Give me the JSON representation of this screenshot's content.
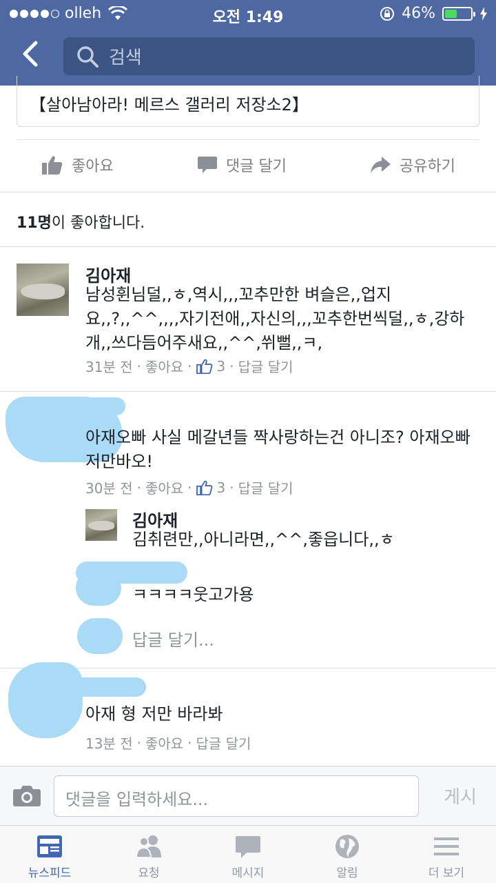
{
  "status_bar": {
    "carrier": "olleh",
    "time": "오전 1:49",
    "battery": "46%",
    "battery_level": 0.46
  },
  "search": {
    "placeholder": "검색"
  },
  "post": {
    "title_fragment": "【살아남아라! 메르스 갤러리 저장소2】"
  },
  "actions": {
    "like": "좋아요",
    "comment": "댓글 달기",
    "share": "공유하기"
  },
  "likes": {
    "count": "11명",
    "suffix": "이 좋아합니다."
  },
  "comments": [
    {
      "author": "김아재",
      "text": "남성휜님덜,,ㅎ,역시,,,꼬추만한 벼슬은,,업지요,,?,,^^,,,,자기전애,,자신의,,,꼬추한번씩덜,,ㅎ,강하개,,쓰다듬어주새요,,^^,쒸뻘,,ㅋ,",
      "time": "31분 전",
      "like": "좋아요",
      "like_count": "3",
      "reply": "답글 달기"
    },
    {
      "author": "",
      "text": "아재오빠 사실 메갈년들 짝사랑하는건 아니조? 아재오빠 저만바오!",
      "time": "30분 전",
      "like": "좋아요",
      "like_count": "3",
      "reply": "답글 달기",
      "replies": [
        {
          "author": "김아재",
          "text": "김취련만,,아니라면,,^^,좋읍니다,,ㅎ"
        },
        {
          "author": "",
          "text": "ㅋㅋㅋㅋ웃고가용"
        }
      ],
      "reply_prompt": "답글 달기..."
    },
    {
      "author": "",
      "text": "아재 형 저만 바라봐",
      "time": "13분 전",
      "like": "좋아요",
      "reply": "답글 달기"
    }
  ],
  "composer": {
    "placeholder": "댓글을 입력하세요...",
    "post_label": "게시"
  },
  "tabs": [
    {
      "label": "뉴스피드",
      "icon": "newsfeed-icon",
      "active": true
    },
    {
      "label": "요청",
      "icon": "friends-icon",
      "active": false
    },
    {
      "label": "메시지",
      "icon": "message-icon",
      "active": false
    },
    {
      "label": "알림",
      "icon": "globe-icon",
      "active": false
    },
    {
      "label": "더 보기",
      "icon": "menu-icon",
      "active": false
    }
  ],
  "colors": {
    "header": "#4e69a2",
    "accent": "#4267b2",
    "muted": "#90949c",
    "redaction": "#a9daf6"
  }
}
